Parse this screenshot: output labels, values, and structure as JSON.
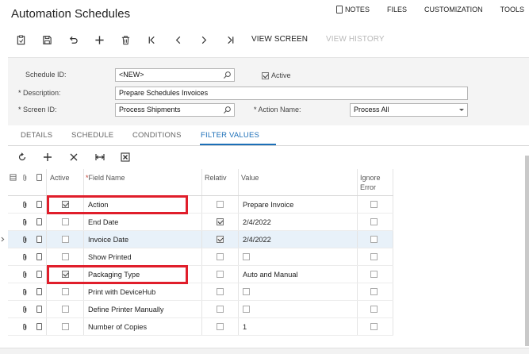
{
  "page": {
    "title": "Automation Schedules"
  },
  "top_links": [
    {
      "label": "NOTES",
      "icon": "note-icon"
    },
    {
      "label": "FILES"
    },
    {
      "label": "CUSTOMIZATION"
    },
    {
      "label": "TOOLS"
    }
  ],
  "toolbar": {
    "view_screen": "VIEW SCREEN",
    "view_history": "VIEW HISTORY",
    "icons": [
      "clipboard-icon",
      "save-icon",
      "undo-icon",
      "add-icon",
      "delete-icon",
      "first-icon",
      "prev-icon",
      "next-icon",
      "last-icon"
    ]
  },
  "form": {
    "schedule_id_label": "Schedule ID:",
    "schedule_id_value": "<NEW>",
    "active_label": "Active",
    "active_checked": true,
    "description_label": "Description:",
    "description_value": "Prepare Schedules Invoices",
    "screen_id_label": "Screen ID:",
    "screen_id_value": "Process Shipments",
    "action_name_label": "Action Name:",
    "action_name_value": "Process All",
    "required_marker": "*"
  },
  "tabs": [
    {
      "label": "DETAILS",
      "active": false
    },
    {
      "label": "SCHEDULE",
      "active": false
    },
    {
      "label": "CONDITIONS",
      "active": false
    },
    {
      "label": "FILTER VALUES",
      "active": true
    }
  ],
  "grid_toolbar_icons": [
    "refresh-icon",
    "add-row-icon",
    "delete-row-icon",
    "fit-columns-icon",
    "export-excel-icon"
  ],
  "grid": {
    "headers": {
      "active": "Active",
      "field_name": "Field Name",
      "relative": "Relativ",
      "value": "Value",
      "ignore_error_1": "Ignore",
      "ignore_error_2": "Error",
      "field_name_required": "*"
    },
    "rows": [
      {
        "active": true,
        "field": "Action",
        "relative": false,
        "value": "Prepare Invoice",
        "value_is_checkbox": false,
        "ignore": false,
        "selected": false,
        "highlighted": true
      },
      {
        "active": false,
        "field": "End Date",
        "relative": true,
        "value": "2/4/2022",
        "value_is_checkbox": false,
        "ignore": false,
        "selected": false,
        "highlighted": false
      },
      {
        "active": false,
        "field": "Invoice Date",
        "relative": true,
        "value": "2/4/2022",
        "value_is_checkbox": false,
        "ignore": false,
        "selected": true,
        "highlighted": false
      },
      {
        "active": false,
        "field": "Show Printed",
        "relative": false,
        "value": "",
        "value_is_checkbox": true,
        "ignore": false,
        "selected": false,
        "highlighted": false
      },
      {
        "active": true,
        "field": "Packaging Type",
        "relative": false,
        "value": "Auto and Manual",
        "value_is_checkbox": false,
        "ignore": false,
        "selected": false,
        "highlighted": true
      },
      {
        "active": false,
        "field": "Print with DeviceHub",
        "relative": false,
        "value": "",
        "value_is_checkbox": true,
        "ignore": false,
        "selected": false,
        "highlighted": false
      },
      {
        "active": false,
        "field": "Define Printer Manually",
        "relative": false,
        "value": "",
        "value_is_checkbox": true,
        "ignore": false,
        "selected": false,
        "highlighted": false
      },
      {
        "active": false,
        "field": "Number of Copies",
        "relative": false,
        "value": "1",
        "value_is_checkbox": false,
        "ignore": false,
        "selected": false,
        "highlighted": false
      }
    ]
  },
  "colors": {
    "accent": "#1c6fb8",
    "highlight": "#e01e2b",
    "selected_row": "#e8f1f9",
    "form_bg": "#f4f4f4"
  }
}
